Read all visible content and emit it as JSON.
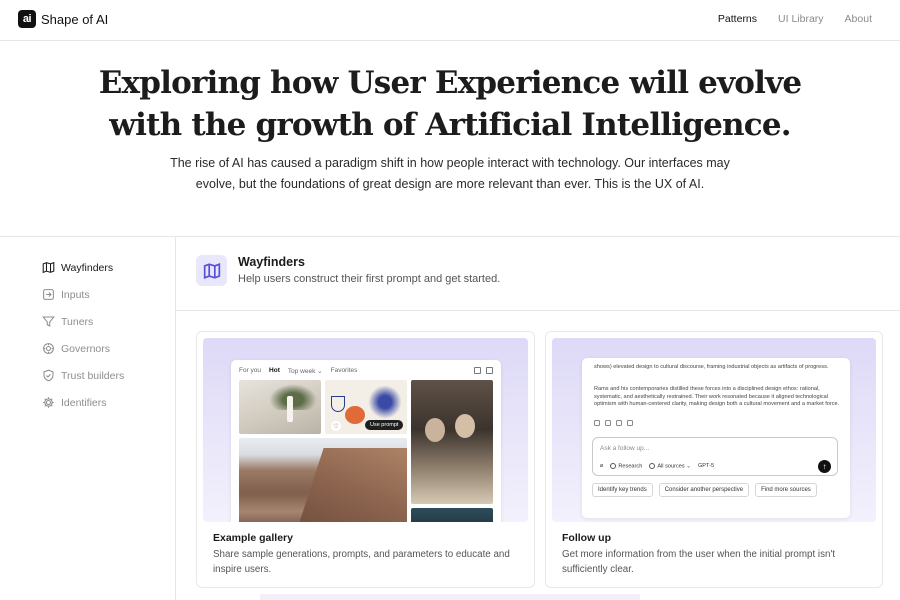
{
  "header": {
    "logo_text": "ai",
    "brand": "Shape of AI",
    "nav": [
      {
        "label": "Patterns",
        "active": true
      },
      {
        "label": "UI Library",
        "active": false
      },
      {
        "label": "About",
        "active": false
      }
    ]
  },
  "hero": {
    "title_line1": "Exploring how User Experience will evolve",
    "title_line2": "with the growth of Artificial Intelligence.",
    "subtitle": "The rise of AI has caused a paradigm shift in how people interact with technology. Our interfaces may evolve, but the foundations of great design are more relevant than ever. This is the UX of AI."
  },
  "sidebar": {
    "items": [
      {
        "label": "Wayfinders",
        "icon": "map-icon",
        "active": true
      },
      {
        "label": "Inputs",
        "icon": "input-arrow-icon",
        "active": false
      },
      {
        "label": "Tuners",
        "icon": "filter-icon",
        "active": false
      },
      {
        "label": "Governors",
        "icon": "governor-icon",
        "active": false
      },
      {
        "label": "Trust builders",
        "icon": "shield-icon",
        "active": false
      },
      {
        "label": "Identifiers",
        "icon": "gear-icon",
        "active": false
      }
    ]
  },
  "section": {
    "icon": "map-icon",
    "title": "Wayfinders",
    "description": "Help users construct their first prompt and get started."
  },
  "cards": [
    {
      "title": "Example gallery",
      "description": "Share sample generations, prompts, and parameters to educate and inspire users.",
      "mock": {
        "tabs": [
          "For you",
          "Hot",
          "Top week ⌄",
          "Favorites"
        ],
        "active_tab": "Hot",
        "use_prompt": "Use prompt"
      }
    },
    {
      "title": "Follow up",
      "description": "Get more information from the user when the initial prompt isn't sufficiently clear.",
      "mock": {
        "text1": "shows) elevated design to cultural discourse, framing industrial objects as artifacts of progress.",
        "text2": "Rams and his contemporaries distilled these forces into a disciplined design ethos: rational, systematic, and aesthetically restrained. Their work resonated because it aligned technological optimism with human-centered clarity, making design both a cultural movement and a market force.",
        "placeholder": "Ask a follow up...",
        "tools": [
          "Research",
          "All sources ⌄",
          "GPT-5"
        ],
        "chips": [
          "Identify key trends",
          "Consider another perspective",
          "Find more sources"
        ]
      }
    }
  ],
  "colors": {
    "accent": "#5750d9",
    "accent_bg": "#e8e7fb",
    "card_gradient_top": "#ddd9f7"
  }
}
